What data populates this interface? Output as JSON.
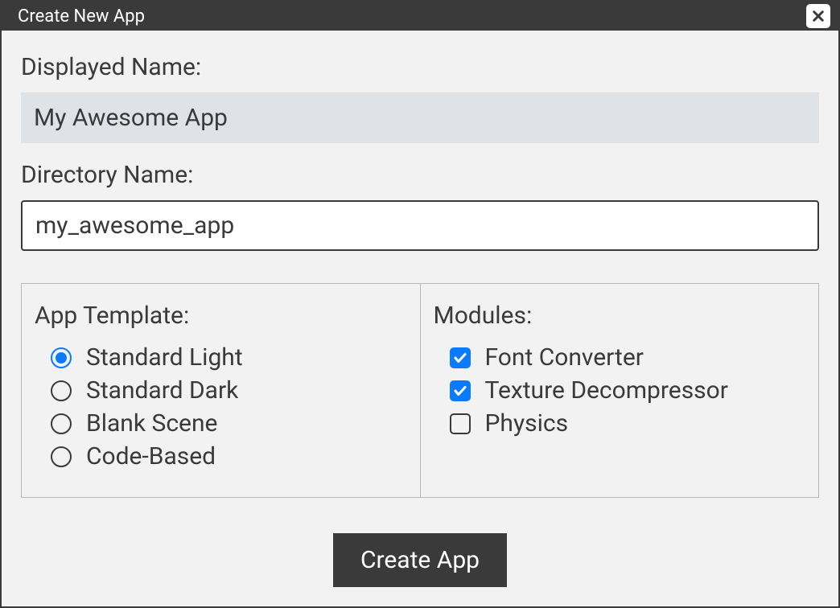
{
  "window": {
    "title": "Create New App"
  },
  "form": {
    "displayedName": {
      "label": "Displayed Name:",
      "value": "My Awesome App"
    },
    "directoryName": {
      "label": "Directory Name:",
      "value": "my_awesome_app"
    }
  },
  "template": {
    "heading": "App Template:",
    "options": [
      {
        "label": "Standard Light",
        "selected": true
      },
      {
        "label": "Standard Dark",
        "selected": false
      },
      {
        "label": "Blank Scene",
        "selected": false
      },
      {
        "label": "Code-Based",
        "selected": false
      }
    ]
  },
  "modules": {
    "heading": "Modules:",
    "options": [
      {
        "label": "Font Converter",
        "checked": true
      },
      {
        "label": "Texture Decompressor",
        "checked": true
      },
      {
        "label": "Physics",
        "checked": false
      }
    ]
  },
  "actions": {
    "createLabel": "Create App"
  }
}
